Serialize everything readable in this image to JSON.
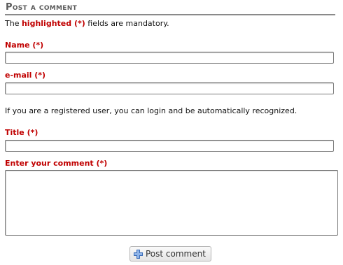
{
  "heading": "Post a comment",
  "intro": {
    "prefix": "The ",
    "highlight": "highlighted (*)",
    "suffix": " fields are mandatory."
  },
  "fields": {
    "name_label": "Name (*)",
    "name_value": "",
    "email_label": "e-mail (*)",
    "email_value": "",
    "title_label": "Title (*)",
    "title_value": "",
    "comment_label": "Enter your comment (*)",
    "comment_value": ""
  },
  "login_note": "If you are a registered user, you can login and be automatically recognized.",
  "submit": {
    "label": "Post comment",
    "icon": "plus-icon"
  },
  "colors": {
    "required": "#c00000",
    "heading": "#5a5a5a"
  }
}
